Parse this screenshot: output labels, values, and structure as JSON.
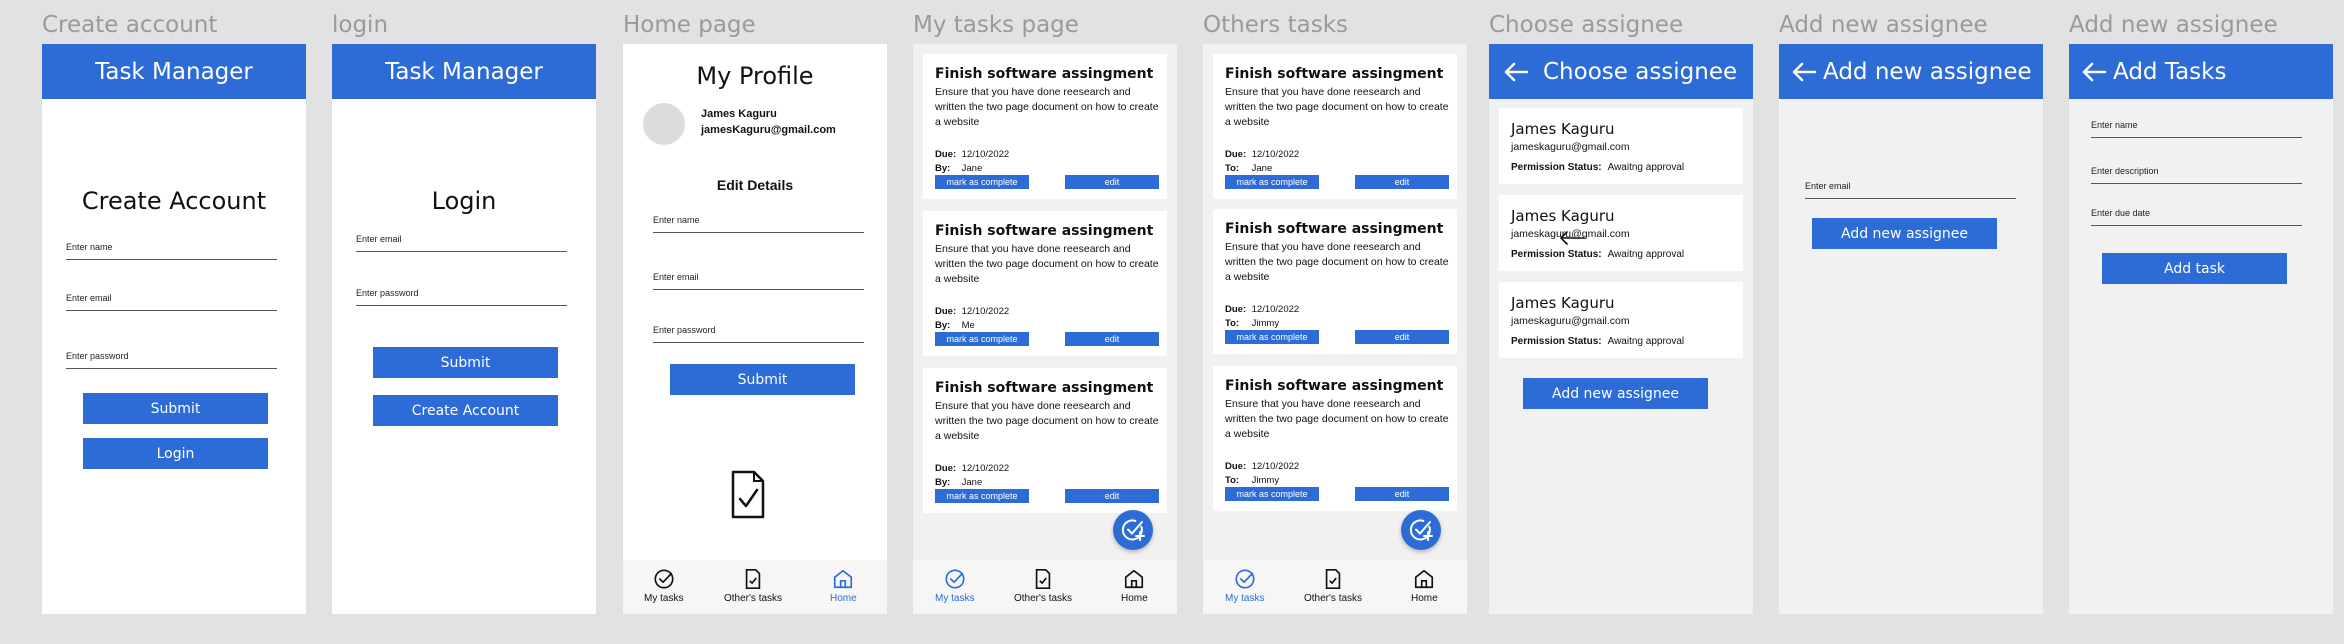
{
  "colors": {
    "primary": "#2d6bd6",
    "background": "#e2e2e2",
    "frame_title": "#9a9a9a"
  },
  "frames": {
    "create_account": {
      "title": "Create account",
      "appbar": "Task Manager",
      "heading": "Create Account",
      "name_placeholder": "Enter name",
      "email_placeholder": "Enter email",
      "password_placeholder": "Enter  password",
      "submit": "Submit",
      "login": "Login"
    },
    "login": {
      "title": "login",
      "appbar": "Task Manager",
      "heading": "Login",
      "email_placeholder": "Enter email",
      "password_placeholder": "Enter  password",
      "submit": "Submit",
      "create_account": "Create Account"
    },
    "home": {
      "title": "Home page",
      "heading": "My Profile",
      "user_name": "James Kaguru",
      "user_email": "jamesKaguru@gmail.com",
      "edit_heading": "Edit Details",
      "name_placeholder": "Enter name",
      "email_placeholder": "Enter email",
      "password_placeholder": "Enter  password",
      "submit": "Submit",
      "document_icon": "document-check-icon"
    },
    "my_tasks": {
      "title": "My tasks page",
      "tasks": [
        {
          "title": "Finish software assingment",
          "description": "Ensure that you have done reesearch and written the two page document on how to create a website",
          "due_label": "Due:",
          "due": "12/10/2022",
          "by_label": "By:",
          "by": "Jane",
          "complete": "mark as complete",
          "edit": "edit"
        },
        {
          "title": "Finish software assingment",
          "description": "Ensure that you have done reesearch and written the two page document on how to create a website",
          "due_label": "Due:",
          "due": "12/10/2022",
          "by_label": "By:",
          "by": "Me",
          "complete": "mark as complete",
          "edit": "edit"
        },
        {
          "title": "Finish software assingment",
          "description": "Ensure that you have done reesearch and written the two page document on how to create a website",
          "due_label": "Due:",
          "due": "12/10/2022",
          "by_label": "By:",
          "by": "Jane",
          "complete": "mark as complete",
          "edit": "edit"
        }
      ]
    },
    "others_tasks": {
      "title": "Others tasks",
      "tasks": [
        {
          "title": "Finish software assingment",
          "description": "Ensure that you have done reesearch and written the two page document on how to create a website",
          "due_label": "Due:",
          "due": "12/10/2022",
          "to_label": "To:",
          "to": "Jane",
          "complete": "mark as complete",
          "edit": "edit"
        },
        {
          "title": "Finish software assingment",
          "description": "Ensure that you have done reesearch and written the two page document on how to create a website",
          "due_label": "Due:",
          "due": "12/10/2022",
          "to_label": "To:",
          "to": "Jimmy",
          "complete": "mark as complete",
          "edit": "edit"
        },
        {
          "title": "Finish software assingment",
          "description": "Ensure that you have done reesearch and written the two page document on how to create a website",
          "due_label": "Due:",
          "due": "12/10/2022",
          "to_label": "To:",
          "to": "Jimmy",
          "complete": "mark as complete",
          "edit": "edit"
        }
      ]
    },
    "choose_assignee": {
      "title": "Choose assignee",
      "appbar": "Choose assignee",
      "assignees": [
        {
          "name": "James Kaguru",
          "email": "jameskaguru@gmail.com",
          "status_label": "Permission Status:",
          "status": "Awaitng approval"
        },
        {
          "name": "James Kaguru",
          "email": "jameskaguru@gmail.com",
          "status_label": "Permission Status:",
          "status": "Awaitng approval"
        },
        {
          "name": "James Kaguru",
          "email": "jameskaguru@gmail.com",
          "status_label": "Permission Status:",
          "status": "Awaitng approval"
        }
      ],
      "add_button": "Add new assignee"
    },
    "add_assignee": {
      "title": "Add new assignee",
      "appbar": "Add new assignee",
      "email_placeholder": "Enter email",
      "add_button": "Add new assignee"
    },
    "add_tasks": {
      "title": "Add new assignee",
      "appbar": "Add Tasks",
      "name_placeholder": "Enter name",
      "description_placeholder": "Enter description",
      "due_placeholder": "Enter due date",
      "add_button": "Add task"
    }
  },
  "nav": {
    "my_tasks": "My tasks",
    "others_tasks": "Other's tasks",
    "home": "Home"
  }
}
